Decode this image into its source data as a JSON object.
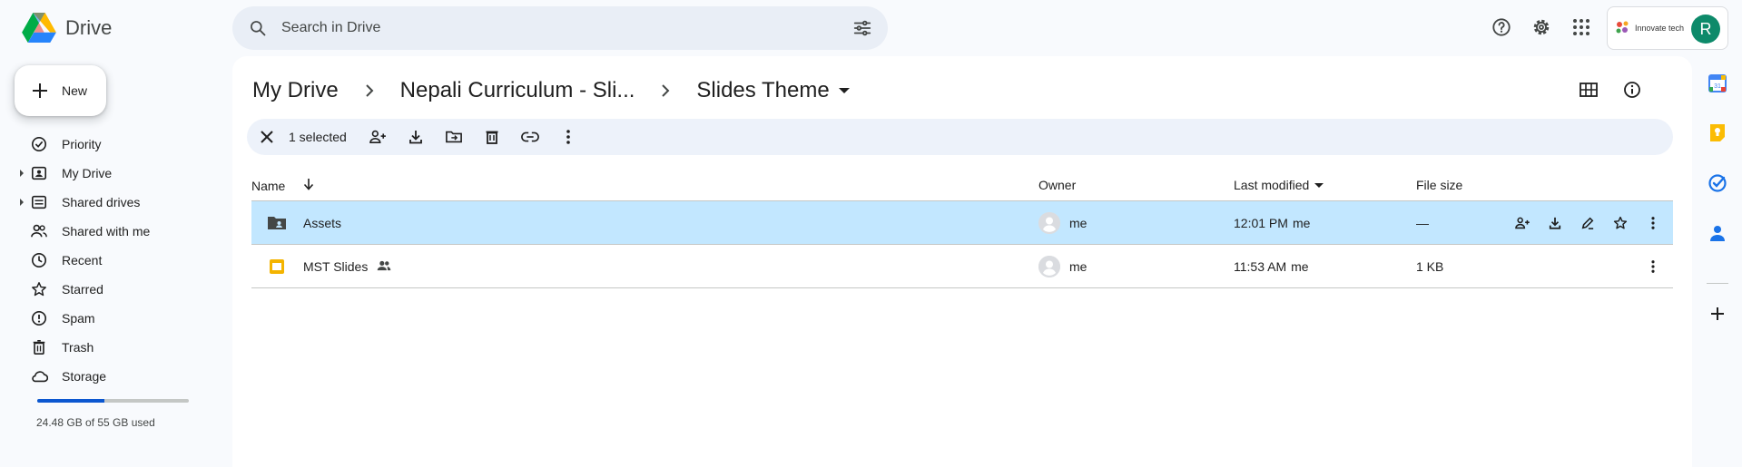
{
  "app": {
    "name": "Drive"
  },
  "search": {
    "placeholder": "Search in Drive"
  },
  "account": {
    "org_name": "Innovate tech",
    "avatar_letter": "R"
  },
  "new_button": {
    "label": "New"
  },
  "sidebar": {
    "items": [
      {
        "label": "Priority",
        "icon": "priority-icon"
      },
      {
        "label": "My Drive",
        "icon": "my-drive-icon",
        "expandable": true
      },
      {
        "label": "Shared drives",
        "icon": "shared-drives-icon",
        "expandable": true
      },
      {
        "label": "Shared with me",
        "icon": "shared-with-me-icon"
      },
      {
        "label": "Recent",
        "icon": "recent-icon"
      },
      {
        "label": "Starred",
        "icon": "star-icon"
      },
      {
        "label": "Spam",
        "icon": "spam-icon"
      },
      {
        "label": "Trash",
        "icon": "trash-icon"
      },
      {
        "label": "Storage",
        "icon": "cloud-icon"
      }
    ],
    "storage": {
      "used_text": "24.48 GB of 55 GB used",
      "fraction": 0.445
    }
  },
  "breadcrumb": [
    "My Drive",
    "Nepali Curriculum - Sli...",
    "Slides Theme"
  ],
  "selection_bar": {
    "count_label": "1 selected"
  },
  "table": {
    "headers": {
      "name": "Name",
      "owner": "Owner",
      "last_modified": "Last modified",
      "file_size": "File size"
    },
    "rows": [
      {
        "name": "Assets",
        "type": "shared-folder",
        "owner": "me",
        "modified_time": "12:01 PM",
        "modified_by": "me",
        "size": "—",
        "selected": true,
        "shared": false
      },
      {
        "name": "MST Slides",
        "type": "slides",
        "owner": "me",
        "modified_time": "11:53 AM",
        "modified_by": "me",
        "size": "1 KB",
        "selected": false,
        "shared": true
      }
    ]
  },
  "colors": {
    "accent": "#0b57d0",
    "selected_row": "#c2e7ff",
    "avatar": "#0d8a6a",
    "slides": "#f4b400"
  }
}
